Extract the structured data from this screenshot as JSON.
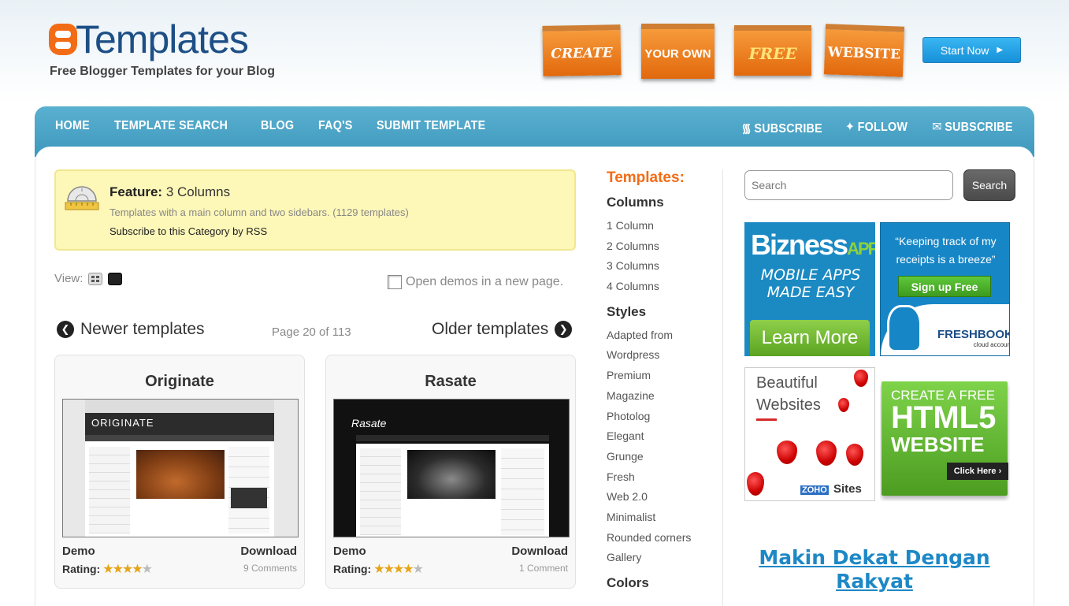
{
  "header": {
    "logo_text": "Templates",
    "tagline": "Free Blogger Templates for your Blog",
    "promo": [
      "CREATE",
      "YOUR OWN",
      "FREE",
      "WEBSITE"
    ],
    "start_now": "Start Now"
  },
  "nav": {
    "left": [
      "HOME",
      "TEMPLATE SEARCH",
      "BLOG",
      "FAQ'S",
      "SUBMIT TEMPLATE"
    ],
    "right": [
      {
        "icon": "rss-icon",
        "label": "SUBSCRIBE"
      },
      {
        "icon": "twitter-icon",
        "label": "FOLLOW"
      },
      {
        "icon": "mail-icon",
        "label": "SUBSCRIBE"
      }
    ]
  },
  "feature": {
    "label": "Feature:",
    "value": "3 Columns",
    "description": "Templates with a main column and two sidebars. (1129 templates)",
    "rss_link": "Subscribe to this Category by RSS"
  },
  "view": {
    "label": "View:",
    "open_demos": "Open demos in a new page."
  },
  "pager": {
    "newer": "Newer templates",
    "page_info": "Page 20 of 113",
    "older": "Older templates"
  },
  "templates": [
    {
      "name": "Originate",
      "demo": "Demo",
      "download": "Download",
      "rating_label": "Rating:",
      "rating": 4,
      "comments": "9 Comments",
      "thumb_title": "ORIGINATE"
    },
    {
      "name": "Rasate",
      "demo": "Demo",
      "download": "Download",
      "rating_label": "Rating:",
      "rating": 4,
      "comments": "1 Comment",
      "thumb_title": "Rasate"
    }
  ],
  "categories": {
    "heading": "Templates:",
    "columns_title": "Columns",
    "columns": [
      "1 Column",
      "2 Columns",
      "3 Columns",
      "4 Columns"
    ],
    "styles_title": "Styles",
    "styles": [
      "Adapted from",
      "Wordpress",
      "Premium",
      "Magazine",
      "Photolog",
      "Elegant",
      "Grunge",
      "Fresh",
      "Web 2.0",
      "Minimalist",
      "Rounded corners",
      "Gallery"
    ],
    "colors_title": "Colors"
  },
  "search": {
    "placeholder": "Search",
    "button": "Search"
  },
  "ads": {
    "bizness": {
      "logo": "Bizness",
      "logo_suffix": "APPS",
      "tagline": "MOBILE APPS MADE EASY",
      "button": "Learn More"
    },
    "freshbooks": {
      "quote": "“Keeping track of my receipts is a breeze”",
      "button": "Sign up Free",
      "logo": "FRESHBOOKS",
      "logo_sub": "cloud accounting"
    },
    "zoho": {
      "text": "Beautiful Websites",
      "brand": "ZOHO",
      "product": "Sites"
    },
    "html5": {
      "line1": "CREATE A FREE",
      "line2": "HTML5",
      "line3": "WEBSITE",
      "click": "Click Here ›"
    }
  },
  "article": {
    "title": "Makin Dekat Dengan Rakyat"
  },
  "colors": {
    "accent_orange": "#f26c16",
    "nav_blue": "#4ba4c8",
    "link_blue": "#1e88c6"
  }
}
